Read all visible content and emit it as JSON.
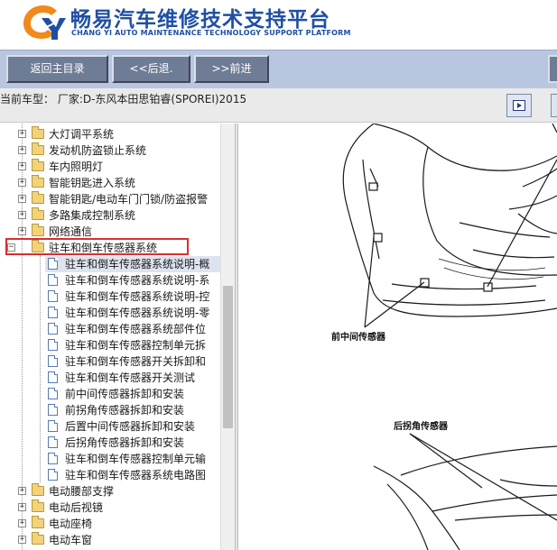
{
  "header": {
    "title": "畅易汽车维修技术支持平台",
    "subtitle": "CHANG YI AUTO MAINTENANCE TECHNOLOGY SUPPORT PLATFORM",
    "brand_color": "#1f4fa3",
    "logo_accent": "#f08a1c"
  },
  "toolbar": {
    "back_main_label": "返回主目录",
    "back_label": "<<后退.",
    "forward_label": ">>前进"
  },
  "vehicle": {
    "text": "当前车型：  厂家:D-东风本田思铂睿(SPOREI)2015"
  },
  "tree": {
    "items_top": [
      {
        "label": "大灯调平系统"
      },
      {
        "label": "发动机防盗锁止系统"
      },
      {
        "label": "车内照明灯"
      },
      {
        "label": "智能钥匙进入系统"
      },
      {
        "label": "智能钥匙/电动车门门锁/防盗报警"
      },
      {
        "label": "多路集成控制系统"
      },
      {
        "label": "网络通信"
      }
    ],
    "expanded_folder": "驻车和倒车传感器系统",
    "children": [
      {
        "label": "驻车和倒车传感器系统说明-概"
      },
      {
        "label": "驻车和倒车传感器系统说明-系"
      },
      {
        "label": "驻车和倒车传感器系统说明-控"
      },
      {
        "label": "驻车和倒车传感器系统说明-零"
      },
      {
        "label": "驻车和倒车传感器系统部件位"
      },
      {
        "label": "驻车和倒车传感器控制单元拆"
      },
      {
        "label": "驻车和倒车传感器开关拆卸和"
      },
      {
        "label": "驻车和倒车传感器开关测试"
      },
      {
        "label": "前中间传感器拆卸和安装"
      },
      {
        "label": "前拐角传感器拆卸和安装"
      },
      {
        "label": "后置中间传感器拆卸和安装"
      },
      {
        "label": "后拐角传感器拆卸和安装"
      },
      {
        "label": "驻车和倒车传感器控制单元输"
      },
      {
        "label": "驻车和倒车传感器系统电路图"
      }
    ],
    "items_bottom": [
      {
        "label": "电动腰部支撑"
      },
      {
        "label": "电动后视镜"
      },
      {
        "label": "电动座椅"
      },
      {
        "label": "电动车窗"
      }
    ],
    "highlight_color": "#d9302c"
  },
  "diagram": {
    "front_label": "前中间传感器",
    "rear_label": "后拐角传感器"
  }
}
